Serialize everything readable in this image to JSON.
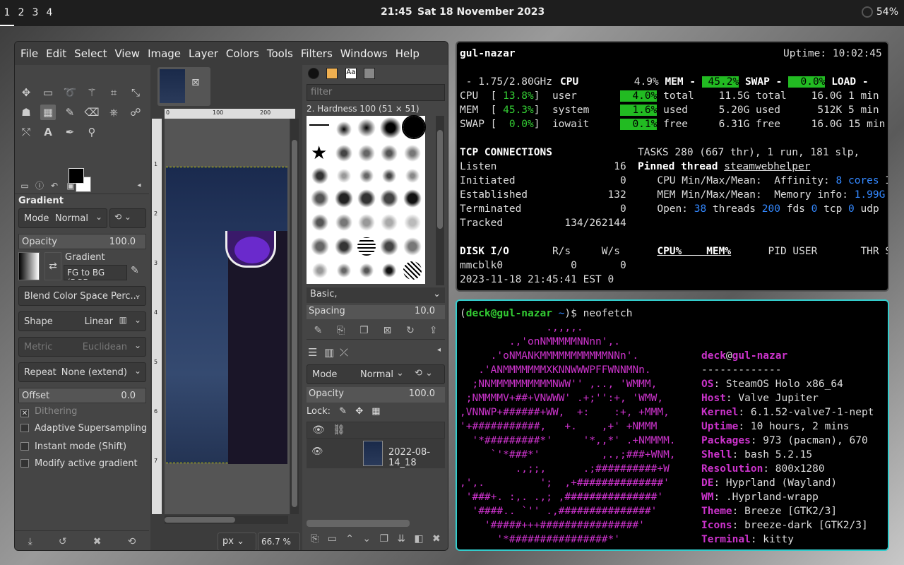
{
  "topbar": {
    "workspaces": [
      "1",
      "2",
      "3",
      "4"
    ],
    "time": "21:45",
    "date": "Sat 18 November 2023",
    "battery": "54%"
  },
  "gimp": {
    "menu": [
      "File",
      "Edit",
      "Select",
      "View",
      "Image",
      "Layer",
      "Colors",
      "Tools",
      "Filters",
      "Windows",
      "Help"
    ],
    "tool_options_title": "Gradient",
    "mode_label": "Mode",
    "mode_value": "Normal",
    "opacity_label": "Opacity",
    "opacity_value": "100.0",
    "gradient_label": "Gradient",
    "gradient_value": "FG to BG (RGB",
    "blend_value": "Blend Color Space Perc...",
    "shape_label": "Shape",
    "shape_value": "Linear",
    "metric_label": "Metric",
    "metric_value": "Euclidean",
    "repeat_label": "Repeat",
    "repeat_value": "None (extend)",
    "offset_label": "Offset",
    "offset_value": "0.0",
    "checkboxes": [
      {
        "label": "Dithering",
        "checked": true,
        "dim": true
      },
      {
        "label": "Adaptive Supersampling",
        "checked": false,
        "dim": false
      },
      {
        "label": "Instant mode  (Shift)",
        "checked": false,
        "dim": false
      },
      {
        "label": "Modify active gradient",
        "checked": false,
        "dim": false
      }
    ],
    "ruler_h": [
      "0",
      "100",
      "200"
    ],
    "ruler_v": [
      "1",
      "2",
      "3",
      "4",
      "5",
      "6",
      "7"
    ],
    "unit": "px",
    "zoom": "66.7 %",
    "brush_filter_placeholder": "filter",
    "brush_name": "2. Hardness 100 (51 × 51)",
    "brush_tag": "Basic,",
    "spacing_label": "Spacing",
    "spacing_value": "10.0",
    "layer_mode_label": "Mode",
    "layer_mode_value": "Normal",
    "layer_opacity_label": "Opacity",
    "layer_opacity_value": "100.0",
    "lock_label": "Lock:",
    "layer_name": "2022-08-14_18"
  },
  "top": {
    "host": "gul-nazar",
    "uptime": "Uptime: 10:02:45",
    "cpu_freq": " - 1.75/2.80GHz",
    "lines": {
      "r1c": "CPU",
      "r1v": "4.9%",
      "mem_h": "MEM -",
      "mem_p": " 45.2%",
      "swap_h": "SWAP -",
      "swap_p": "  0.0%",
      "load_h": "LOAD -"
    },
    "tcp_title": "TCP CONNECTIONS",
    "tasks": "TASKS 280 (667 thr), 1 run, 181 slp,",
    "pinned": "Pinned thread",
    "pinned_name": "steamwebhelper",
    "disk_title": "DISK I/O",
    "datetime": "2023-11-18 21:45:41 EST 0"
  },
  "neofetch": {
    "prompt_user": "deck@gul-nazar",
    "prompt_dir": " ~",
    "command": "$ neofetch",
    "user": "deck",
    "host": "gul-nazar",
    "sep": "-------------",
    "info": [
      {
        "k": "OS",
        "v": ": SteamOS Holo x86_64"
      },
      {
        "k": "Host",
        "v": ": Valve Jupiter"
      },
      {
        "k": "Kernel",
        "v": ": 6.1.52-valve7-1-nept"
      },
      {
        "k": "Uptime",
        "v": ": 10 hours, 2 mins"
      },
      {
        "k": "Packages",
        "v": ": 973 (pacman), 670"
      },
      {
        "k": "Shell",
        "v": ": bash 5.2.15"
      },
      {
        "k": "Resolution",
        "v": ": 800x1280"
      },
      {
        "k": "DE",
        "v": ": Hyprland (Wayland)"
      },
      {
        "k": "WM",
        "v": ": .Hyprland-wrapp"
      },
      {
        "k": "Theme",
        "v": ": Breeze [GTK2/3]"
      },
      {
        "k": "Icons",
        "v": ": breeze-dark [GTK2/3]"
      },
      {
        "k": "Terminal",
        "v": ": kitty"
      }
    ],
    "logo": [
      "              .,,,,.",
      "        .,'onNMMMMMNNnn',.",
      "     .'oNMANKMMMMMMMMMMMNNn'.",
      "   .'ANMMMMMMMXKNNWWWPFFWNNMNn.",
      "  ;NNMMMMMMMMMMNWW'' ,.., 'WMMM,",
      " ;NMMMMV+##+VNWWW' .+;'':+, 'WMW,",
      ",VNNWP+######+WW,  +:    :+, +MMM,",
      "'+###########,   +.    ,+' +NMMM",
      "  '*#########*'     '*,,*' .+NMMMM.",
      "     `'*###*'          ,.,;###+WNM,",
      "         .,;;,      .;##########+W",
      ",',.         ';  ,+##############'",
      " '###+. :,. .,; ,###############'",
      "  '####.. `'' .,###############'",
      "    '#####+++################'",
      "      '*################*'"
    ]
  }
}
